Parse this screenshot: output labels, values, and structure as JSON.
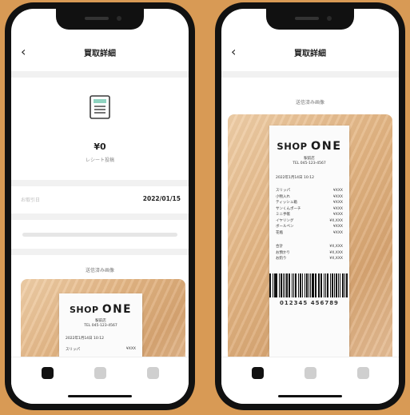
{
  "left": {
    "header": {
      "back_icon": "chevron-left-icon",
      "title": "買取詳細"
    },
    "amount": "¥0",
    "amount_sub": "レシート投稿",
    "date_label": "お取引日",
    "date_value": "2022/01/15",
    "image_section_label": "送信済み画像",
    "receipt": {
      "shop_prefix": "SHOP",
      "shop_suffix": "ONE",
      "branch": "駅前店",
      "tel": "TEL 045-123-4567",
      "datetime": "2022年1月14日 10:12",
      "first_item": "スリッパ",
      "first_price": "¥XXX"
    },
    "tabs": [
      {
        "name": "tab-home",
        "active": true
      },
      {
        "name": "tab-2",
        "active": false
      },
      {
        "name": "tab-3",
        "active": false
      }
    ]
  },
  "right": {
    "header": {
      "back_icon": "chevron-left-icon",
      "title": "買取詳細"
    },
    "image_section_label": "送信済み画像",
    "receipt": {
      "shop_prefix": "SHOP",
      "shop_suffix": "ONE",
      "branch": "駅前店",
      "tel": "TEL 045-123-4567",
      "datetime": "2022年1月14日 10:12",
      "items": [
        {
          "name": "スリッパ",
          "price": "¥XXX"
        },
        {
          "name": "小物入れ",
          "price": "¥XXX"
        },
        {
          "name": "ティッシュ箱",
          "price": "¥XXX"
        },
        {
          "name": "サンくんポーチ",
          "price": "¥XXX"
        },
        {
          "name": "ミニ手帳",
          "price": "¥XXX"
        },
        {
          "name": "イヤリング",
          "price": "¥X,XXX"
        },
        {
          "name": "ボールペン",
          "price": "¥XXX"
        },
        {
          "name": "花瓶",
          "price": "¥XXX"
        }
      ],
      "totals": [
        {
          "name": "合計",
          "price": "¥X,XXX"
        },
        {
          "name": "お預かり",
          "price": "¥X,XXX"
        },
        {
          "name": "お釣り",
          "price": "¥X,XXX"
        }
      ],
      "barcode_number": "012345 456789"
    },
    "tabs": [
      {
        "name": "tab-home",
        "active": true
      },
      {
        "name": "tab-2",
        "active": false
      },
      {
        "name": "tab-3",
        "active": false
      }
    ]
  },
  "colors": {
    "background": "#d89a55",
    "phone_frame": "#111111",
    "accent_icon": "#8fd3c0"
  }
}
